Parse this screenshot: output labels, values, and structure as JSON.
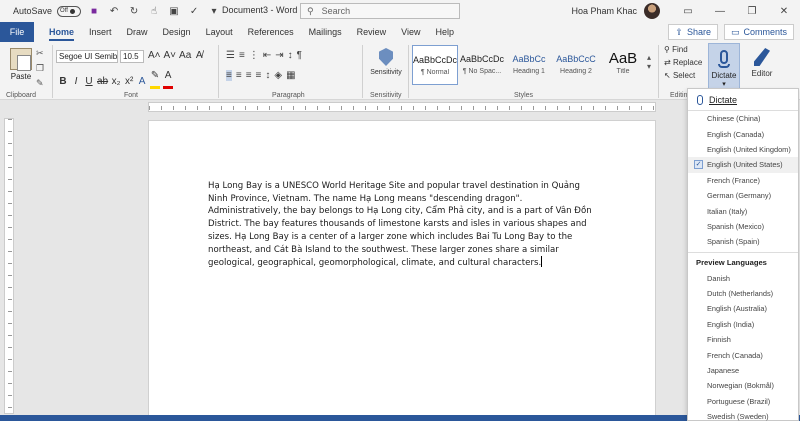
{
  "titlebar": {
    "autosave_label": "AutoSave",
    "autosave_state": "Off",
    "doc_title": "Document3 - Word",
    "search_placeholder": "Search",
    "user_name": "Hoa Pham Khac"
  },
  "tabs": {
    "file": "File",
    "items": [
      "Home",
      "Insert",
      "Draw",
      "Design",
      "Layout",
      "References",
      "Mailings",
      "Review",
      "View",
      "Help"
    ],
    "active": "Home",
    "share": "Share",
    "comments": "Comments"
  },
  "ribbon": {
    "clipboard": {
      "paste": "Paste",
      "group": "Clipboard"
    },
    "font": {
      "name": "Segoe UI Semibo",
      "size": "10.5",
      "group": "Font"
    },
    "paragraph": {
      "group": "Paragraph"
    },
    "sensitivity": {
      "label": "Sensitivity",
      "group": "Sensitivity"
    },
    "styles": {
      "group": "Styles",
      "items": [
        {
          "sample": "AaBbCcDc",
          "name": "¶ Normal"
        },
        {
          "sample": "AaBbCcDc",
          "name": "¶ No Spac..."
        },
        {
          "sample": "AaBbCc",
          "name": "Heading 1"
        },
        {
          "sample": "AaBbCcC",
          "name": "Heading 2"
        },
        {
          "sample": "AaB",
          "name": "Title"
        }
      ]
    },
    "editing": {
      "find": "Find",
      "replace": "Replace",
      "select": "Select",
      "group": "Editing"
    },
    "dictate": {
      "label": "Dictate"
    },
    "editor": {
      "label": "Editor"
    }
  },
  "document": {
    "text": "Hạ Long Bay is a UNESCO World Heritage Site and popular travel destination in Quảng Ninh Province, Vietnam. The name Hạ Long means \"descending dragon\". Administratively, the bay belongs to Hạ Long city, Cẩm Phả city, and is a part of Vân Đồn District. The bay features thousands of limestone karsts and isles in various shapes and sizes. Hạ Long Bay is a center of a larger zone which includes Bai Tu Long Bay to the northeast, and Cát Bà Island to the southwest. These larger zones share a similar geological, geographical, geomorphological, climate, and cultural characters."
  },
  "dictate_menu": {
    "header": "Dictate",
    "languages": [
      "Chinese (China)",
      "English (Canada)",
      "English (United Kingdom)",
      "English (United States)",
      "French (France)",
      "German (Germany)",
      "Italian (Italy)",
      "Spanish (Mexico)",
      "Spanish (Spain)"
    ],
    "selected": "English (United States)",
    "preview_header": "Preview Languages",
    "preview": [
      "Danish",
      "Dutch (Netherlands)",
      "English (Australia)",
      "English (India)",
      "Finnish",
      "French (Canada)",
      "Japanese",
      "Norwegian (Bokmål)",
      "Portuguese (Brazil)",
      "Swedish (Sweden)"
    ]
  },
  "colors": {
    "accent": "#2b579a",
    "highlight": "#ffd800",
    "font_color": "#e00000"
  }
}
